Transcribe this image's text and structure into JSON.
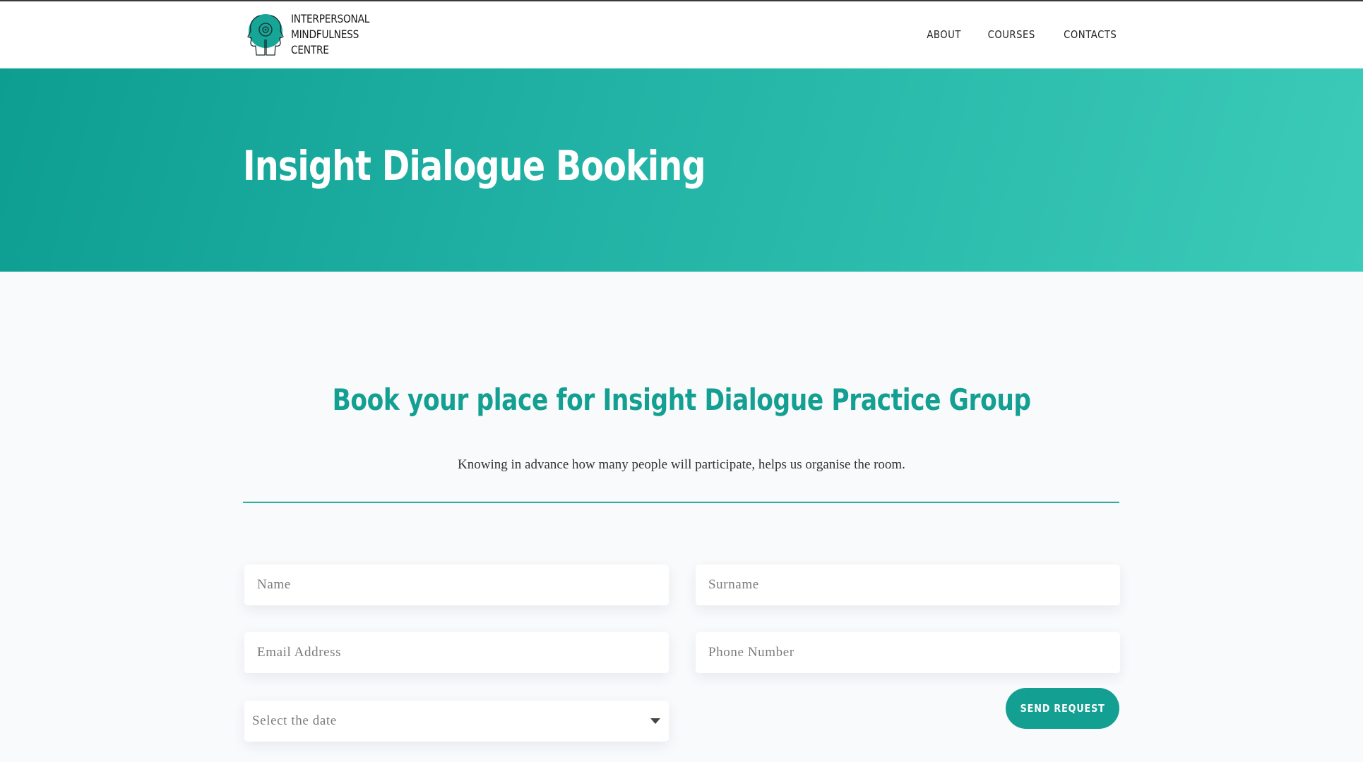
{
  "brand": {
    "logo_icon": "head-profile-logo-icon",
    "name_lines": [
      "INTERPERSONAL",
      "MINDFULNESS",
      "CENTRE"
    ]
  },
  "nav": {
    "items": [
      {
        "label": "ABOUT"
      },
      {
        "label": "COURSES"
      },
      {
        "label": "CONTACTS"
      }
    ]
  },
  "hero": {
    "title": "Insight Dialogue Booking"
  },
  "booking": {
    "heading": "Book your place for Insight Dialogue Practice Group",
    "description": "Knowing in advance how many people will participate, helps us organise the room.",
    "fields": {
      "name": {
        "placeholder": "Name",
        "value": ""
      },
      "surname": {
        "placeholder": "Surname",
        "value": ""
      },
      "email": {
        "placeholder": "Email Address",
        "value": ""
      },
      "phone": {
        "placeholder": "Phone Number",
        "value": ""
      }
    },
    "date_select": {
      "selected": "Select the date"
    },
    "submit_label": "SEND REQUEST"
  },
  "colors": {
    "accent": "#139f92",
    "hero_gradient_start": "#0d9e91",
    "hero_gradient_end": "#3ccbb8",
    "page_background": "#f9fafc"
  }
}
